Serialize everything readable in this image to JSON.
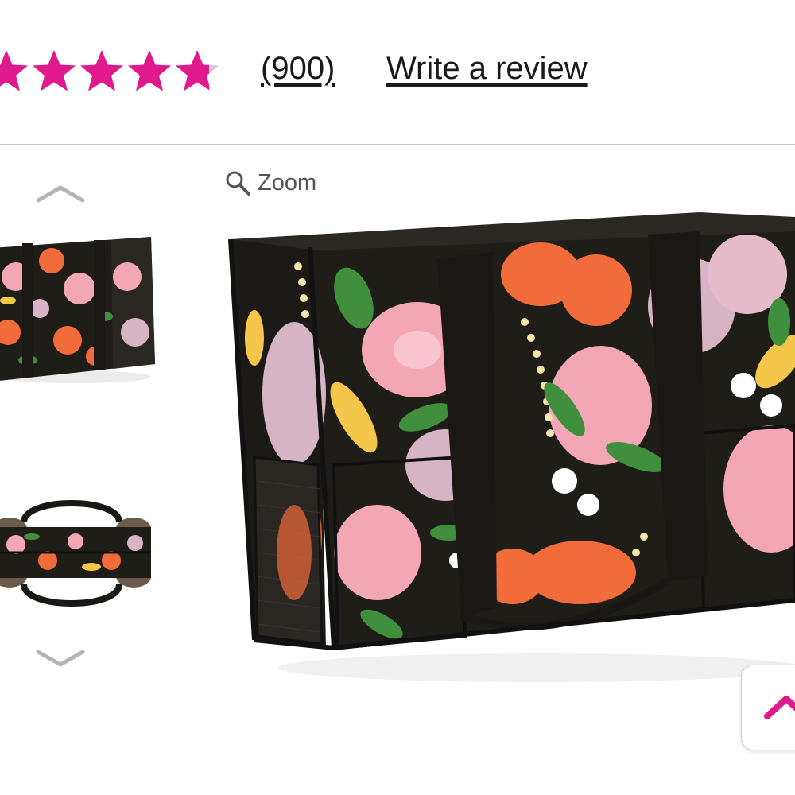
{
  "rating": {
    "stars_value": 4.75,
    "stars_max": 5,
    "star_color": "#e0198d",
    "star_empty_color": "#cccccc",
    "review_count": "(900)",
    "write_review_label": "Write a review"
  },
  "gallery": {
    "zoom_label": "Zoom",
    "prev_icon": "chevron-up-icon",
    "next_icon": "chevron-down-icon",
    "thumbnails": [
      {
        "view": "front"
      },
      {
        "view": "top"
      }
    ]
  },
  "product": {
    "print_colors": {
      "background": "#1f1d18",
      "pink": "#f3a7b5",
      "orange": "#f26b3a",
      "yellow": "#f4c64a",
      "green": "#3f8f3c",
      "white": "#ffffff",
      "strap": "#1a1714"
    }
  },
  "scroll_top": {
    "icon": "chevron-up-icon",
    "color": "#e0198d"
  }
}
